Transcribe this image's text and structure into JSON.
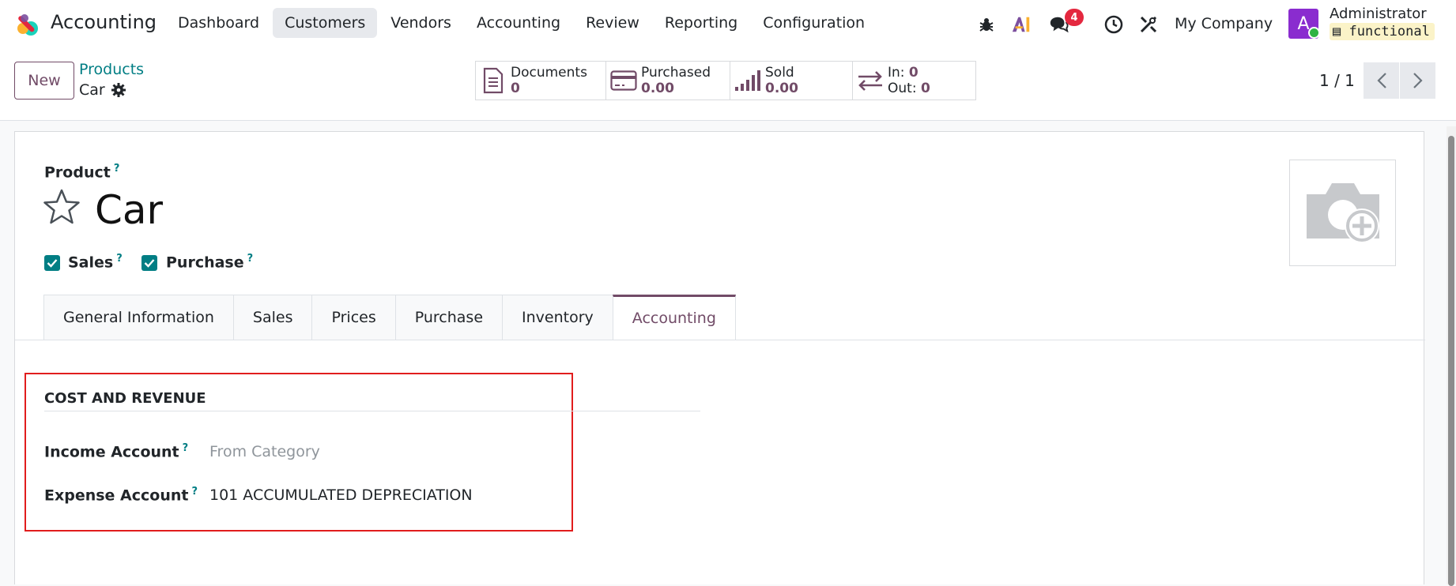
{
  "app": {
    "name": "Accounting"
  },
  "menu": [
    {
      "label": "Dashboard",
      "active": false
    },
    {
      "label": "Customers",
      "active": true
    },
    {
      "label": "Vendors",
      "active": false
    },
    {
      "label": "Accounting",
      "active": false
    },
    {
      "label": "Review",
      "active": false
    },
    {
      "label": "Reporting",
      "active": false
    },
    {
      "label": "Configuration",
      "active": false
    }
  ],
  "systray": {
    "messages_badge": "4",
    "company": "My Company",
    "avatar_letter": "A",
    "user": "Administrator",
    "db": "functional"
  },
  "control": {
    "new_label": "New",
    "breadcrumb_parent": "Products",
    "breadcrumb_current": "Car",
    "pager": "1 / 1"
  },
  "stats": {
    "documents": {
      "label": "Documents",
      "value": "0"
    },
    "purchased": {
      "label": "Purchased",
      "value": "0.00"
    },
    "sold": {
      "label": "Sold",
      "value": "0.00"
    },
    "moves": {
      "in_label": "In:",
      "in_value": "0",
      "out_label": "Out:",
      "out_value": "0"
    }
  },
  "form": {
    "product_label": "Product",
    "help_mark": "?",
    "product_name": "Car",
    "sales_label": "Sales",
    "purchase_label": "Purchase"
  },
  "tabs": [
    {
      "label": "General Information",
      "active": false
    },
    {
      "label": "Sales",
      "active": false
    },
    {
      "label": "Prices",
      "active": false
    },
    {
      "label": "Purchase",
      "active": false
    },
    {
      "label": "Inventory",
      "active": false
    },
    {
      "label": "Accounting",
      "active": true
    }
  ],
  "section": {
    "title": "COST AND REVENUE",
    "income_label": "Income Account",
    "income_placeholder": "From Category",
    "expense_label": "Expense Account",
    "expense_value": "101 ACCUMULATED DEPRECIATION"
  },
  "colors": {
    "brand": "#714b67",
    "teal": "#017e84",
    "highlight": "#e11d1d"
  }
}
